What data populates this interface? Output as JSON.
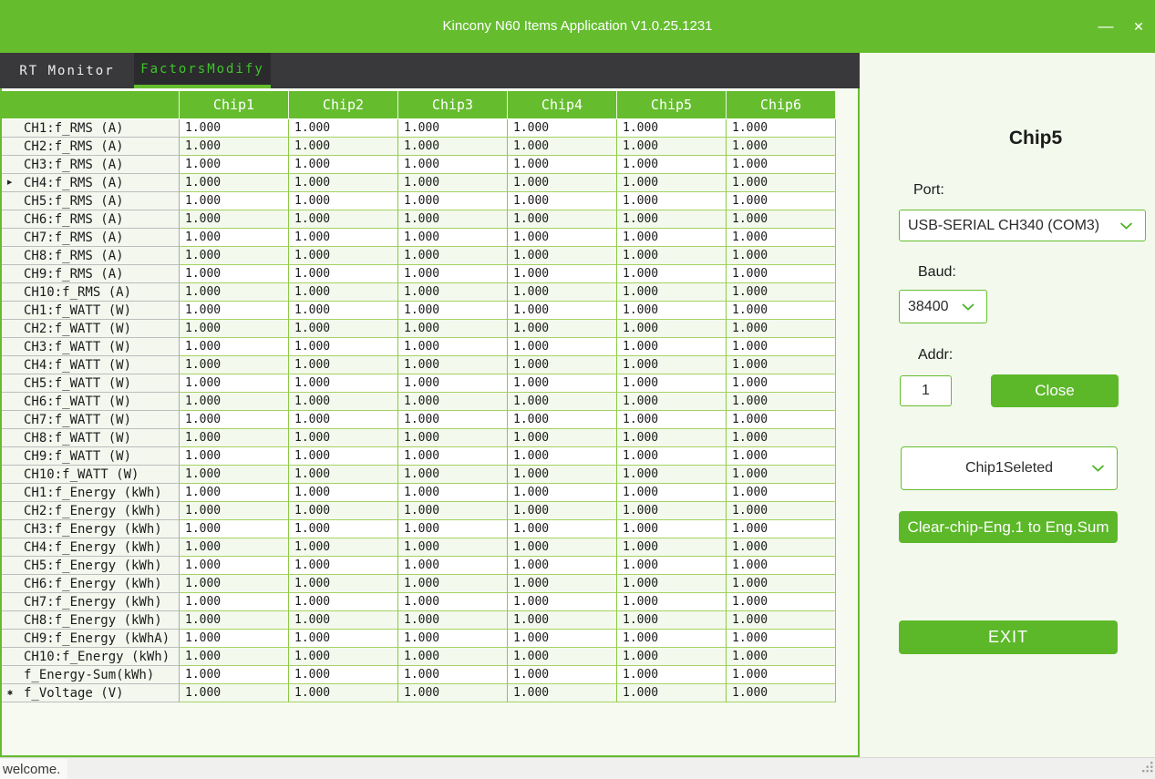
{
  "window": {
    "title": "Kincony N60 Items Application V1.0.25.1231"
  },
  "icons": {
    "minimize": "—",
    "close": "✕"
  },
  "tabs": [
    {
      "label": "RT Monitor",
      "active": false
    },
    {
      "label": "FactorsModify",
      "active": true
    }
  ],
  "table": {
    "columns": [
      "Chip1",
      "Chip2",
      "Chip3",
      "Chip4",
      "Chip5",
      "Chip6"
    ],
    "current_row_icon": "▶",
    "new_row_icon": "✱",
    "selected": {
      "row_index": 3,
      "col_index": 0,
      "row_label": "CH4:f_RMS (A)",
      "column": "Chip1"
    },
    "rows": [
      {
        "label": "CH1:f_RMS (A)",
        "values": [
          "1.000",
          "1.000",
          "1.000",
          "1.000",
          "1.000",
          "1.000"
        ]
      },
      {
        "label": "CH2:f_RMS (A)",
        "values": [
          "1.000",
          "1.000",
          "1.000",
          "1.000",
          "1.000",
          "1.000"
        ]
      },
      {
        "label": "CH3:f_RMS (A)",
        "values": [
          "1.000",
          "1.000",
          "1.000",
          "1.000",
          "1.000",
          "1.000"
        ]
      },
      {
        "label": "CH4:f_RMS (A)",
        "values": [
          "1.000",
          "1.000",
          "1.000",
          "1.000",
          "1.000",
          "1.000"
        ]
      },
      {
        "label": "CH5:f_RMS (A)",
        "values": [
          "1.000",
          "1.000",
          "1.000",
          "1.000",
          "1.000",
          "1.000"
        ]
      },
      {
        "label": "CH6:f_RMS (A)",
        "values": [
          "1.000",
          "1.000",
          "1.000",
          "1.000",
          "1.000",
          "1.000"
        ]
      },
      {
        "label": "CH7:f_RMS (A)",
        "values": [
          "1.000",
          "1.000",
          "1.000",
          "1.000",
          "1.000",
          "1.000"
        ]
      },
      {
        "label": "CH8:f_RMS (A)",
        "values": [
          "1.000",
          "1.000",
          "1.000",
          "1.000",
          "1.000",
          "1.000"
        ]
      },
      {
        "label": "CH9:f_RMS (A)",
        "values": [
          "1.000",
          "1.000",
          "1.000",
          "1.000",
          "1.000",
          "1.000"
        ]
      },
      {
        "label": "CH10:f_RMS (A)",
        "values": [
          "1.000",
          "1.000",
          "1.000",
          "1.000",
          "1.000",
          "1.000"
        ]
      },
      {
        "label": "CH1:f_WATT (W)",
        "values": [
          "1.000",
          "1.000",
          "1.000",
          "1.000",
          "1.000",
          "1.000"
        ]
      },
      {
        "label": "CH2:f_WATT (W)",
        "values": [
          "1.000",
          "1.000",
          "1.000",
          "1.000",
          "1.000",
          "1.000"
        ]
      },
      {
        "label": "CH3:f_WATT (W)",
        "values": [
          "1.000",
          "1.000",
          "1.000",
          "1.000",
          "1.000",
          "1.000"
        ]
      },
      {
        "label": "CH4:f_WATT (W)",
        "values": [
          "1.000",
          "1.000",
          "1.000",
          "1.000",
          "1.000",
          "1.000"
        ]
      },
      {
        "label": "CH5:f_WATT (W)",
        "values": [
          "1.000",
          "1.000",
          "1.000",
          "1.000",
          "1.000",
          "1.000"
        ]
      },
      {
        "label": "CH6:f_WATT (W)",
        "values": [
          "1.000",
          "1.000",
          "1.000",
          "1.000",
          "1.000",
          "1.000"
        ]
      },
      {
        "label": "CH7:f_WATT (W)",
        "values": [
          "1.000",
          "1.000",
          "1.000",
          "1.000",
          "1.000",
          "1.000"
        ]
      },
      {
        "label": "CH8:f_WATT (W)",
        "values": [
          "1.000",
          "1.000",
          "1.000",
          "1.000",
          "1.000",
          "1.000"
        ]
      },
      {
        "label": "CH9:f_WATT (W)",
        "values": [
          "1.000",
          "1.000",
          "1.000",
          "1.000",
          "1.000",
          "1.000"
        ]
      },
      {
        "label": "CH10:f_WATT (W)",
        "values": [
          "1.000",
          "1.000",
          "1.000",
          "1.000",
          "1.000",
          "1.000"
        ]
      },
      {
        "label": "CH1:f_Energy (kWh)",
        "values": [
          "1.000",
          "1.000",
          "1.000",
          "1.000",
          "1.000",
          "1.000"
        ]
      },
      {
        "label": "CH2:f_Energy (kWh)",
        "values": [
          "1.000",
          "1.000",
          "1.000",
          "1.000",
          "1.000",
          "1.000"
        ]
      },
      {
        "label": "CH3:f_Energy (kWh)",
        "values": [
          "1.000",
          "1.000",
          "1.000",
          "1.000",
          "1.000",
          "1.000"
        ]
      },
      {
        "label": "CH4:f_Energy (kWh)",
        "values": [
          "1.000",
          "1.000",
          "1.000",
          "1.000",
          "1.000",
          "1.000"
        ]
      },
      {
        "label": "CH5:f_Energy (kWh)",
        "values": [
          "1.000",
          "1.000",
          "1.000",
          "1.000",
          "1.000",
          "1.000"
        ]
      },
      {
        "label": "CH6:f_Energy (kWh)",
        "values": [
          "1.000",
          "1.000",
          "1.000",
          "1.000",
          "1.000",
          "1.000"
        ]
      },
      {
        "label": "CH7:f_Energy (kWh)",
        "values": [
          "1.000",
          "1.000",
          "1.000",
          "1.000",
          "1.000",
          "1.000"
        ]
      },
      {
        "label": "CH8:f_Energy (kWh)",
        "values": [
          "1.000",
          "1.000",
          "1.000",
          "1.000",
          "1.000",
          "1.000"
        ]
      },
      {
        "label": "CH9:f_Energy (kWhA)",
        "values": [
          "1.000",
          "1.000",
          "1.000",
          "1.000",
          "1.000",
          "1.000"
        ]
      },
      {
        "label": "CH10:f_Energy (kWh)",
        "values": [
          "1.000",
          "1.000",
          "1.000",
          "1.000",
          "1.000",
          "1.000"
        ]
      },
      {
        "label": "f_Energy-Sum(kWh)",
        "values": [
          "1.000",
          "1.000",
          "1.000",
          "1.000",
          "1.000",
          "1.000"
        ]
      },
      {
        "label": "f_Voltage (V)",
        "values": [
          "1.000",
          "1.000",
          "1.000",
          "1.000",
          "1.000",
          "1.000"
        ]
      }
    ]
  },
  "panel": {
    "title": "Chip5",
    "port_label": "Port:",
    "port_value": "USB-SERIAL CH340 (COM3)",
    "baud_label": "Baud:",
    "baud_value": "38400",
    "addr_label": "Addr:",
    "addr_value": "1",
    "close_button": "Close",
    "chip_select_value": "Chip1Seleted",
    "clear_button": "Clear-chip-Eng.1 to Eng.Sum",
    "exit_button": "EXIT"
  },
  "status_bar": {
    "message": "welcome."
  },
  "colors": {
    "accent_green": "#65bd2e",
    "button_green": "#5cb829",
    "tab_bar_dark": "#39393b",
    "active_tab_text": "#3fc42c",
    "grid_line_green": "#8cc944",
    "panel_bg": "#f3f9ed",
    "status_bar_bg": "#f0f0ee"
  }
}
